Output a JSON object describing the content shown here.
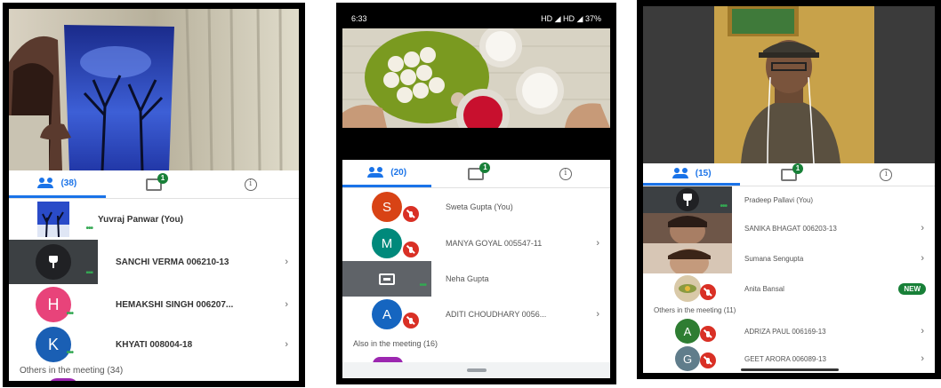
{
  "panel1": {
    "tabs": {
      "participants_count": "(38)",
      "chat_badge": "1"
    },
    "participants": [
      {
        "name": "Yuvraj Panwar (You)"
      },
      {
        "name": "SANCHI VERMA 006210-13"
      },
      {
        "name": "HEMAKSHI SINGH 006207...",
        "initial": "H",
        "color": "#e8437a"
      },
      {
        "name": "KHYATI 008004-18",
        "initial": "K",
        "color": "#1a5fb4"
      }
    ],
    "others_label": "Others in the meeting (34)"
  },
  "panel2": {
    "status_bar": {
      "time": "6:33",
      "right": "HD ◢ HD ◢ 37%"
    },
    "tabs": {
      "participants_count": "(20)",
      "chat_badge": "1"
    },
    "participants": [
      {
        "name": "Sweta Gupta (You)",
        "initial": "S",
        "color": "#d84315"
      },
      {
        "name": "MANYA GOYAL 005547-11",
        "initial": "M",
        "color": "#00897b"
      },
      {
        "name": "Neha Gupta"
      },
      {
        "name": "ADITI CHOUDHARY 0056...",
        "initial": "A",
        "color": "#1565c0"
      }
    ],
    "others_label": "Also in the meeting (16)"
  },
  "panel3": {
    "tabs": {
      "participants_count": "(15)",
      "chat_badge": "1"
    },
    "participants": [
      {
        "name": "Pradeep Pallavi (You)"
      },
      {
        "name": "SANIKA BHAGAT 006203-13"
      },
      {
        "name": "Sumana Sengupta"
      },
      {
        "name": "Anita Bansal",
        "badge": "NEW"
      },
      {
        "name": "ADRIZA PAUL 006169-13",
        "initial": "A",
        "color": "#2e7d32"
      },
      {
        "name": "GEET ARORA 006089-13",
        "initial": "G",
        "color": "#607d8b"
      }
    ],
    "others_label": "Others in the meeting (11)"
  },
  "icons": {
    "people": "people-icon",
    "chat": "chat-icon",
    "info": "info-icon",
    "chevron": "›",
    "info_glyph": "i"
  }
}
